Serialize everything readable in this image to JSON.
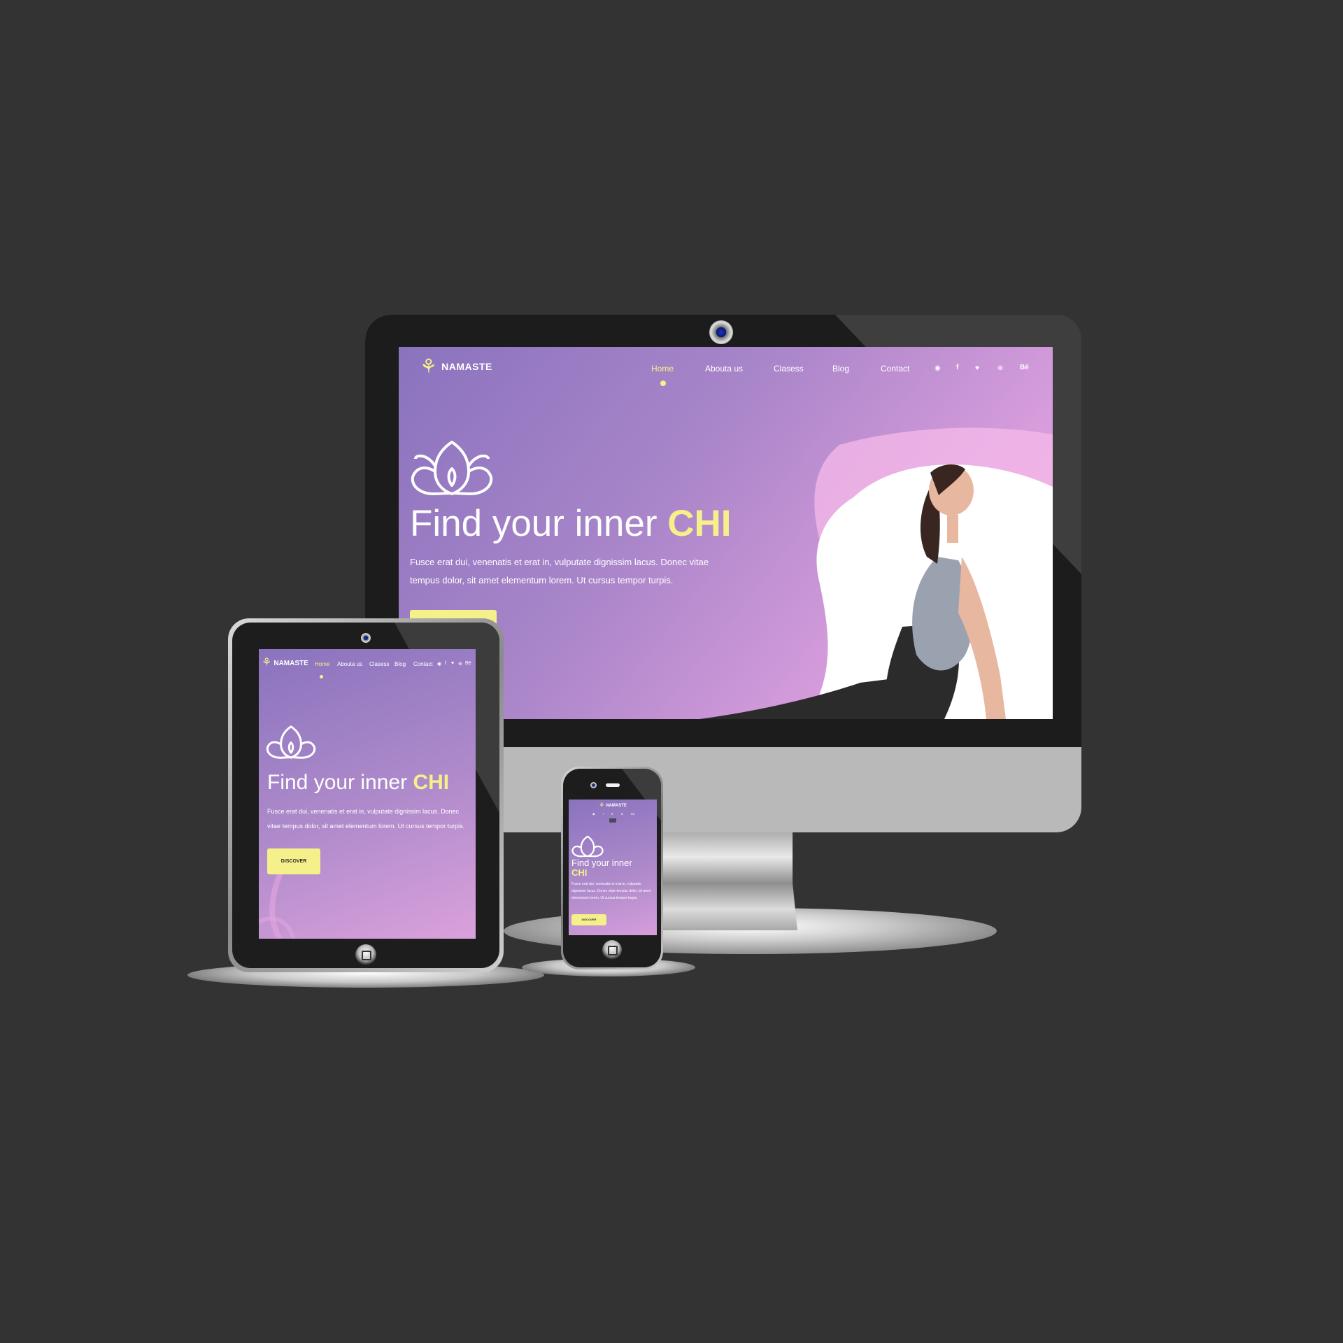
{
  "site": {
    "brand": "NAMASTE",
    "nav": [
      "Home",
      "Abouta us",
      "Clasess",
      "Blog",
      "Contact"
    ],
    "social_icons": [
      "pinterest-icon",
      "facebook-icon",
      "twitter-icon",
      "dribbble-icon",
      "behance-icon"
    ],
    "behance_text": "Bē",
    "hero": {
      "title_lead": "Find your inner ",
      "title_accent": "CHI",
      "body": "Fusce erat dui, venenatis et erat in, vulputate dignissim lacus. Donec vitae tempus dolor, sit amet elementum lorem. Ut cursus tempor turpis.",
      "cta": "DISCOVER"
    }
  },
  "colors": {
    "background": "#333333",
    "accent": "#f6f08a",
    "gradient_start": "#8a73be",
    "gradient_end": "#e9a3de"
  }
}
